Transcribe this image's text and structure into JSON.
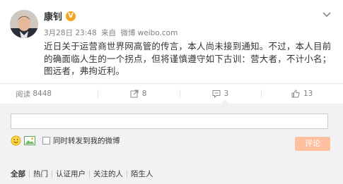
{
  "user": {
    "name": "康钊",
    "verified_mark": "V"
  },
  "meta": {
    "date": "3月28日 23:48",
    "from_label": "来自",
    "source": "微博 weibo.com"
  },
  "post": {
    "text": "近日关于运营商世界网高管的传言，本人尚未接到通知。不过，本人目前的确面临人生的一个拐点，但将谨慎遵守如下古训：营大者，不计小名；图远者，弗拘近利。"
  },
  "actions": {
    "read_label": "阅读",
    "read_count": "8448",
    "repost_count": "8",
    "comment_count": "3",
    "like_count": "13"
  },
  "comment": {
    "input_value": "",
    "repost_checkbox_label": "同时转发到我的微博",
    "submit_label": "评论"
  },
  "filters": [
    "全部",
    "热门",
    "认证用户",
    "关注的人",
    "陌生人"
  ],
  "colors": {
    "verified": "#f5a623",
    "submit_disabled": "#ffc09f",
    "comment_bg": "#f2f2f5"
  },
  "icons": {
    "chevron": "chevron-down-icon",
    "repost": "repost-icon",
    "comment": "comment-icon",
    "like": "thumbs-up-icon",
    "emoji": "smiley-icon",
    "image": "image-icon"
  }
}
